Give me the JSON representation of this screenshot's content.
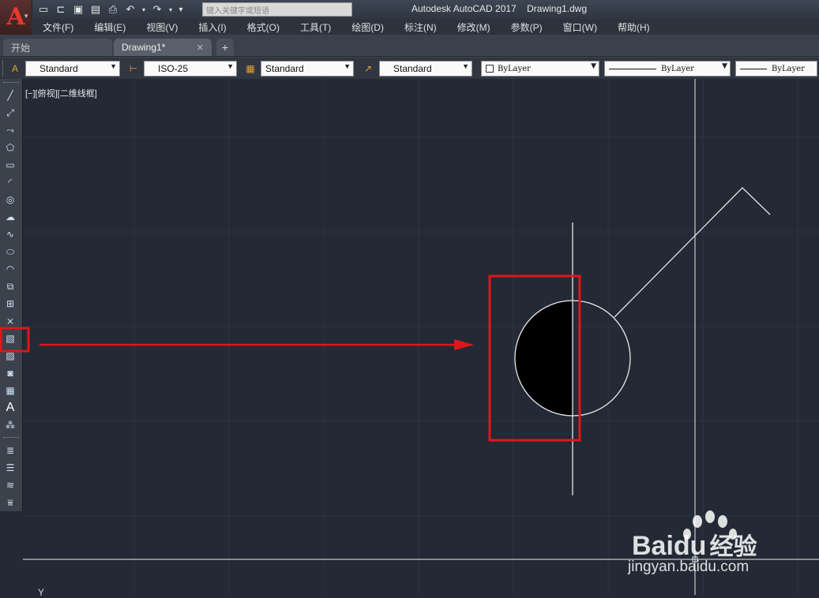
{
  "window": {
    "title": "Autodesk AutoCAD 2017",
    "file": "Drawing1.dwg",
    "app_logo": "A",
    "search_placeholder": "键入关键字或短语"
  },
  "menu": [
    "文件(F)",
    "编辑(E)",
    "视图(V)",
    "插入(I)",
    "格式(O)",
    "工具(T)",
    "绘图(D)",
    "标注(N)",
    "修改(M)",
    "参数(P)",
    "窗口(W)",
    "帮助(H)"
  ],
  "tabs": [
    {
      "label": "开始"
    },
    {
      "label": "Drawing1*"
    }
  ],
  "styles_toolbar": {
    "text_style": "Standard",
    "dim_style": "ISO-25",
    "table_style": "Standard",
    "mleader_style": "Standard",
    "color": "ByLayer",
    "linetype": "ByLayer",
    "lineweight": "ByLayer"
  },
  "viewport": {
    "label": "[−][俯视][二维线框]",
    "ucs_marker": "Y"
  },
  "watermark": {
    "brand": "Baidu",
    "suffix": "经验",
    "url": "jingyan.baidu.com"
  },
  "colors": {
    "canvas": "#232a35",
    "highlight": "#e0161a",
    "geometry": "#e8e8e8"
  },
  "icons": {
    "active_tool": "region-icon"
  }
}
